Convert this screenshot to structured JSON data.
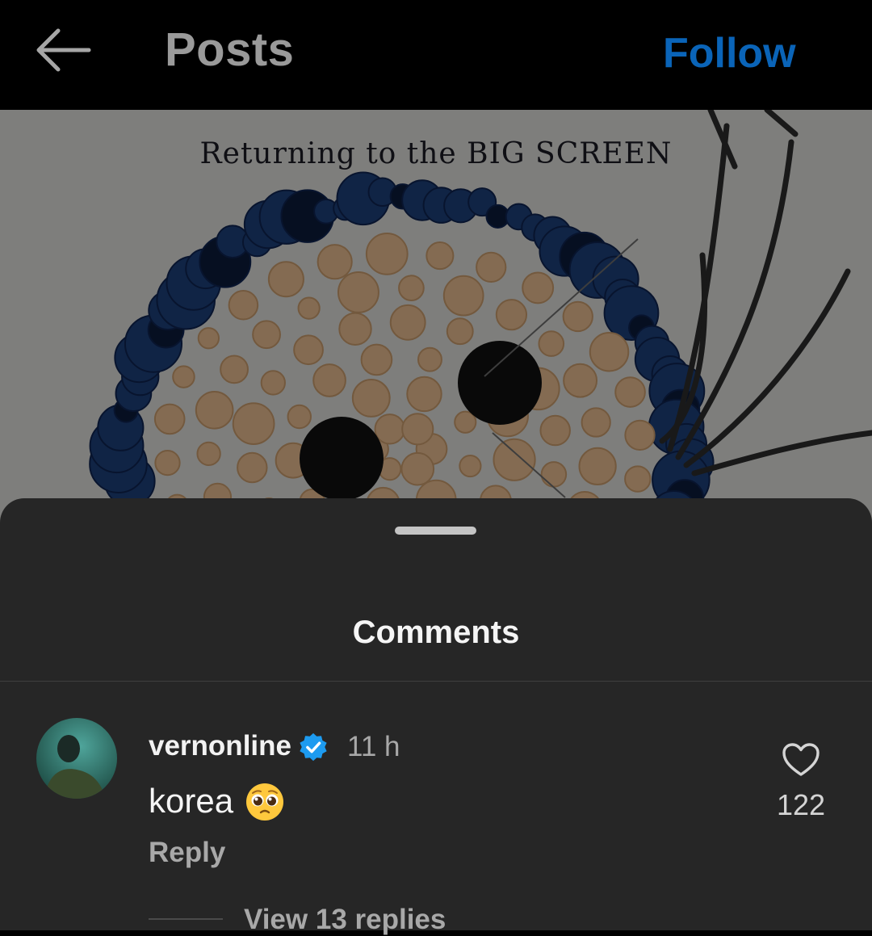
{
  "header": {
    "title": "Posts",
    "back_icon": "arrow-left-icon",
    "follow_label": "Follow",
    "follow_color": "#0a64b8"
  },
  "post": {
    "caption_text": "Returning to the BIG SCREEN"
  },
  "comments_sheet": {
    "title": "Comments",
    "comments": [
      {
        "username": "vernonline",
        "verified": true,
        "verified_icon": "verified-badge-icon",
        "time": "11 h",
        "text": "korea",
        "emoji_icon": "pleading-face-emoji-icon",
        "reply_label": "Reply",
        "like_icon": "heart-outline-icon",
        "like_count": "122",
        "view_replies_label": "View 13 replies"
      }
    ]
  },
  "colors": {
    "background": "#000000",
    "sheet": "#262626",
    "accent": "#0a64b8",
    "verified": "#1d9bf0"
  }
}
